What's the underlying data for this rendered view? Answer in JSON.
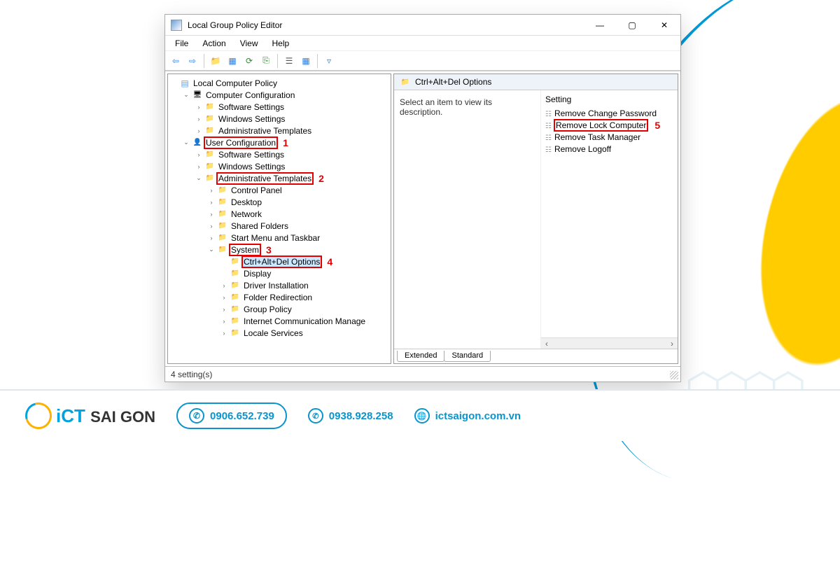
{
  "window": {
    "title": "Local Group Policy Editor",
    "menu": [
      "File",
      "Action",
      "View",
      "Help"
    ]
  },
  "tree": {
    "root": "Local Computer Policy",
    "computer_config": "Computer Configuration",
    "cc_children": [
      "Software Settings",
      "Windows Settings",
      "Administrative Templates"
    ],
    "user_config": "User Configuration",
    "uc_software": "Software Settings",
    "uc_windows": "Windows Settings",
    "uc_admin": "Administrative Templates",
    "admin_children": [
      "Control Panel",
      "Desktop",
      "Network",
      "Shared Folders",
      "Start Menu and Taskbar"
    ],
    "system": "System",
    "system_target": "Ctrl+Alt+Del Options",
    "system_rest": [
      "Display",
      "Driver Installation",
      "Folder Redirection",
      "Group Policy",
      "Internet Communication Manage",
      "Locale Services"
    ]
  },
  "callouts": {
    "1": "1",
    "2": "2",
    "3": "3",
    "4": "4",
    "5": "5"
  },
  "content": {
    "header": "Ctrl+Alt+Del Options",
    "description_prompt": "Select an item to view its description.",
    "column": "Setting",
    "items": [
      "Remove Change Password",
      "Remove Lock Computer",
      "Remove Task Manager",
      "Remove Logoff"
    ]
  },
  "tabs": {
    "extended": "Extended",
    "standard": "Standard"
  },
  "status": "4 setting(s)",
  "footer": {
    "brand1": "iCT",
    "brand2": "SAI GON",
    "phone1": "0906.652.739",
    "phone2": "0938.928.258",
    "site": "ictsaigon.com.vn"
  }
}
